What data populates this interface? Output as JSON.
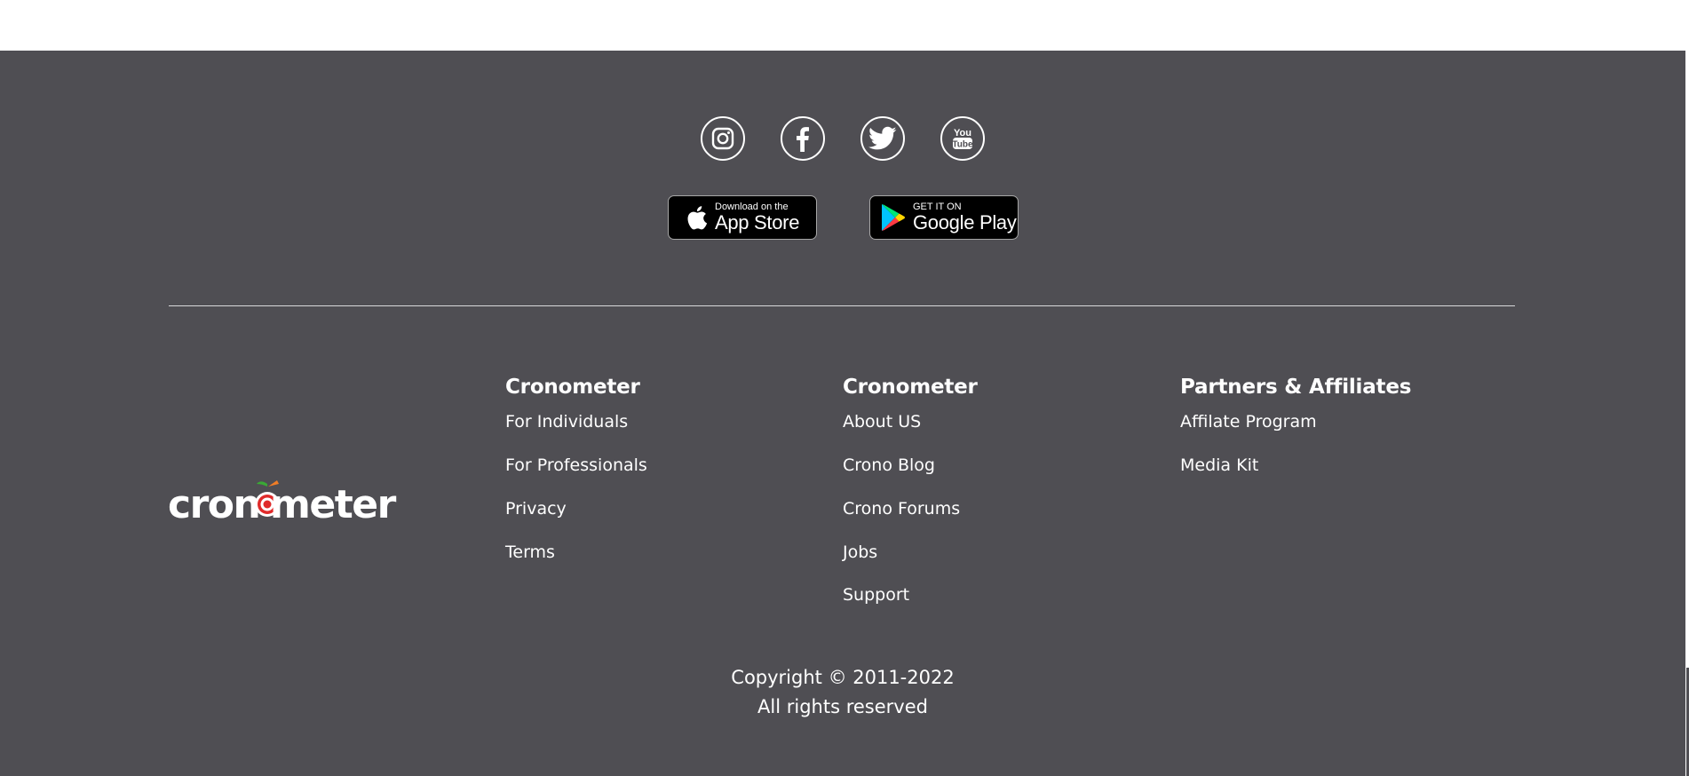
{
  "colors": {
    "footer_bg": "#4f4e53",
    "text": "#ffffff",
    "divider": "#d9d9db",
    "logo_apple_red": "#e02b2b",
    "logo_leaf_green": "#3aa935",
    "logo_carrot_orange": "#f07d26"
  },
  "social": [
    {
      "name": "Instagram",
      "icon": "instagram-icon"
    },
    {
      "name": "Facebook",
      "icon": "facebook-icon"
    },
    {
      "name": "Twitter",
      "icon": "twitter-icon"
    },
    {
      "name": "YouTube",
      "icon": "youtube-icon"
    }
  ],
  "badges": {
    "app_store": {
      "small": "Download on the",
      "big": "App Store",
      "icon": "apple-icon"
    },
    "google_play": {
      "small": "GET IT ON",
      "big": "Google Play",
      "icon": "google-play-icon"
    }
  },
  "logo": {
    "text_left": "cron",
    "text_right": "meter",
    "icon": "apple-target-icon"
  },
  "columns": [
    {
      "title": "Cronometer",
      "links": [
        "For Individuals",
        "For Professionals",
        "Privacy",
        "Terms"
      ]
    },
    {
      "title": "Cronometer",
      "links": [
        "About US",
        "Crono Blog",
        "Crono Forums",
        "Jobs",
        "Support"
      ]
    },
    {
      "title": "Partners & Affiliates",
      "links": [
        "Affilate Program",
        "Media Kit"
      ]
    }
  ],
  "copyright": {
    "line1": "Copyright © 2011-2022",
    "line2": "All rights reserved"
  }
}
